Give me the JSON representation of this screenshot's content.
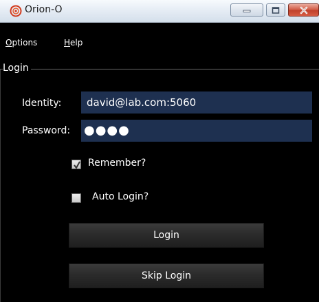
{
  "window": {
    "title": "Orion-O",
    "icon": "orion-app-icon",
    "controls": {
      "minimize": "minimize-icon",
      "maximize": "maximize-icon",
      "close": "close-icon"
    }
  },
  "menubar": {
    "options": {
      "mnemonic": "O",
      "rest": "ptions"
    },
    "help": {
      "mnemonic": "H",
      "rest": "elp"
    }
  },
  "login": {
    "group_title": "Login",
    "identity_label": "Identity:",
    "identity_value": "david@lab.com:5060",
    "password_label": "Password:",
    "password_mask": "●●●●",
    "remember_label": "Remember?",
    "remember_checked": true,
    "auto_login_label": "Auto Login?",
    "auto_login_checked": false,
    "login_button": "Login",
    "skip_login_button": "Skip Login"
  },
  "colors": {
    "background": "#000000",
    "field_bg": "#1e3050",
    "button_bg": "#2a2a2a",
    "text": "#ffffff",
    "close_red": "#c0412b"
  }
}
